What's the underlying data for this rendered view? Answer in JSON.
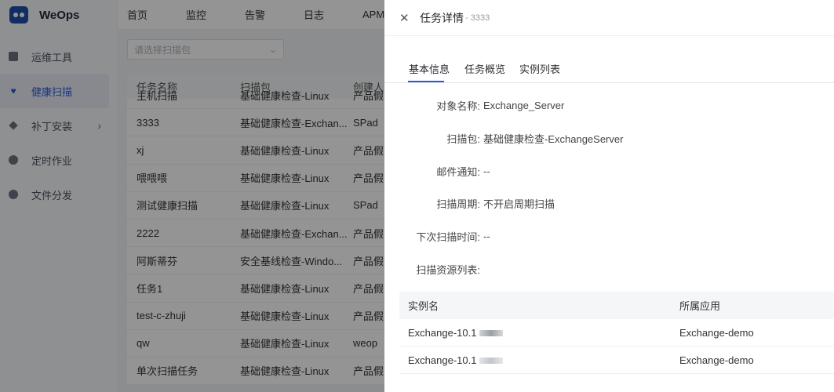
{
  "app": {
    "name": "WeOps"
  },
  "top_nav": [
    "首页",
    "监控",
    "告警",
    "日志",
    "APM"
  ],
  "sidebar": {
    "items": [
      {
        "label": "运维工具",
        "icon": "toolbox-icon"
      },
      {
        "label": "健康扫描",
        "icon": "heart-icon",
        "active": true
      },
      {
        "label": "补丁安装",
        "icon": "patch-icon"
      },
      {
        "label": "定时作业",
        "icon": "clock-icon"
      },
      {
        "label": "文件分发",
        "icon": "file-distribute-icon"
      }
    ]
  },
  "filter": {
    "placeholder": "请选择扫描包"
  },
  "list": {
    "columns": [
      "任务名称",
      "扫描包",
      "创建人"
    ],
    "rows": [
      [
        "主机扫描",
        "基础健康检查-Linux",
        "产品假"
      ],
      [
        "3333",
        "基础健康检查-Exchan...",
        "SPad"
      ],
      [
        "xj",
        "基础健康检查-Linux",
        "产品假"
      ],
      [
        "喂喂喂",
        "基础健康检查-Linux",
        "产品假"
      ],
      [
        "测试健康扫描",
        "基础健康检查-Linux",
        "SPad"
      ],
      [
        "2222",
        "基础健康检查-Exchan...",
        "产品假"
      ],
      [
        "阿斯蒂芬",
        "安全基线检查-Windo...",
        "产品假"
      ],
      [
        "任务1",
        "基础健康检查-Linux",
        "产品假"
      ],
      [
        "test-c-zhuji",
        "基础健康检查-Linux",
        "产品假"
      ],
      [
        "qw",
        "基础健康检查-Linux",
        "weop"
      ],
      [
        "单次扫描任务",
        "基础健康检查-Linux",
        "产品假"
      ]
    ]
  },
  "drawer": {
    "title": "任务详情",
    "subtitle": "- 3333",
    "tabs": [
      "基本信息",
      "任务概览",
      "实例列表"
    ],
    "fields": [
      {
        "label": "对象名称:",
        "value": "Exchange_Server"
      },
      {
        "label": "扫描包:",
        "value": "基础健康检查-ExchangeServer"
      },
      {
        "label": "邮件通知:",
        "value": "--"
      },
      {
        "label": "扫描周期:",
        "value": "不开启周期扫描"
      },
      {
        "label": "下次扫描时间:",
        "value": "--"
      },
      {
        "label": "扫描资源列表:",
        "value": ""
      }
    ],
    "resources": {
      "columns": [
        "实例名",
        "所属应用"
      ],
      "rows": [
        [
          "Exchange-10.1",
          "Exchange-demo"
        ],
        [
          "Exchange-10.1",
          "Exchange-demo"
        ]
      ]
    }
  }
}
